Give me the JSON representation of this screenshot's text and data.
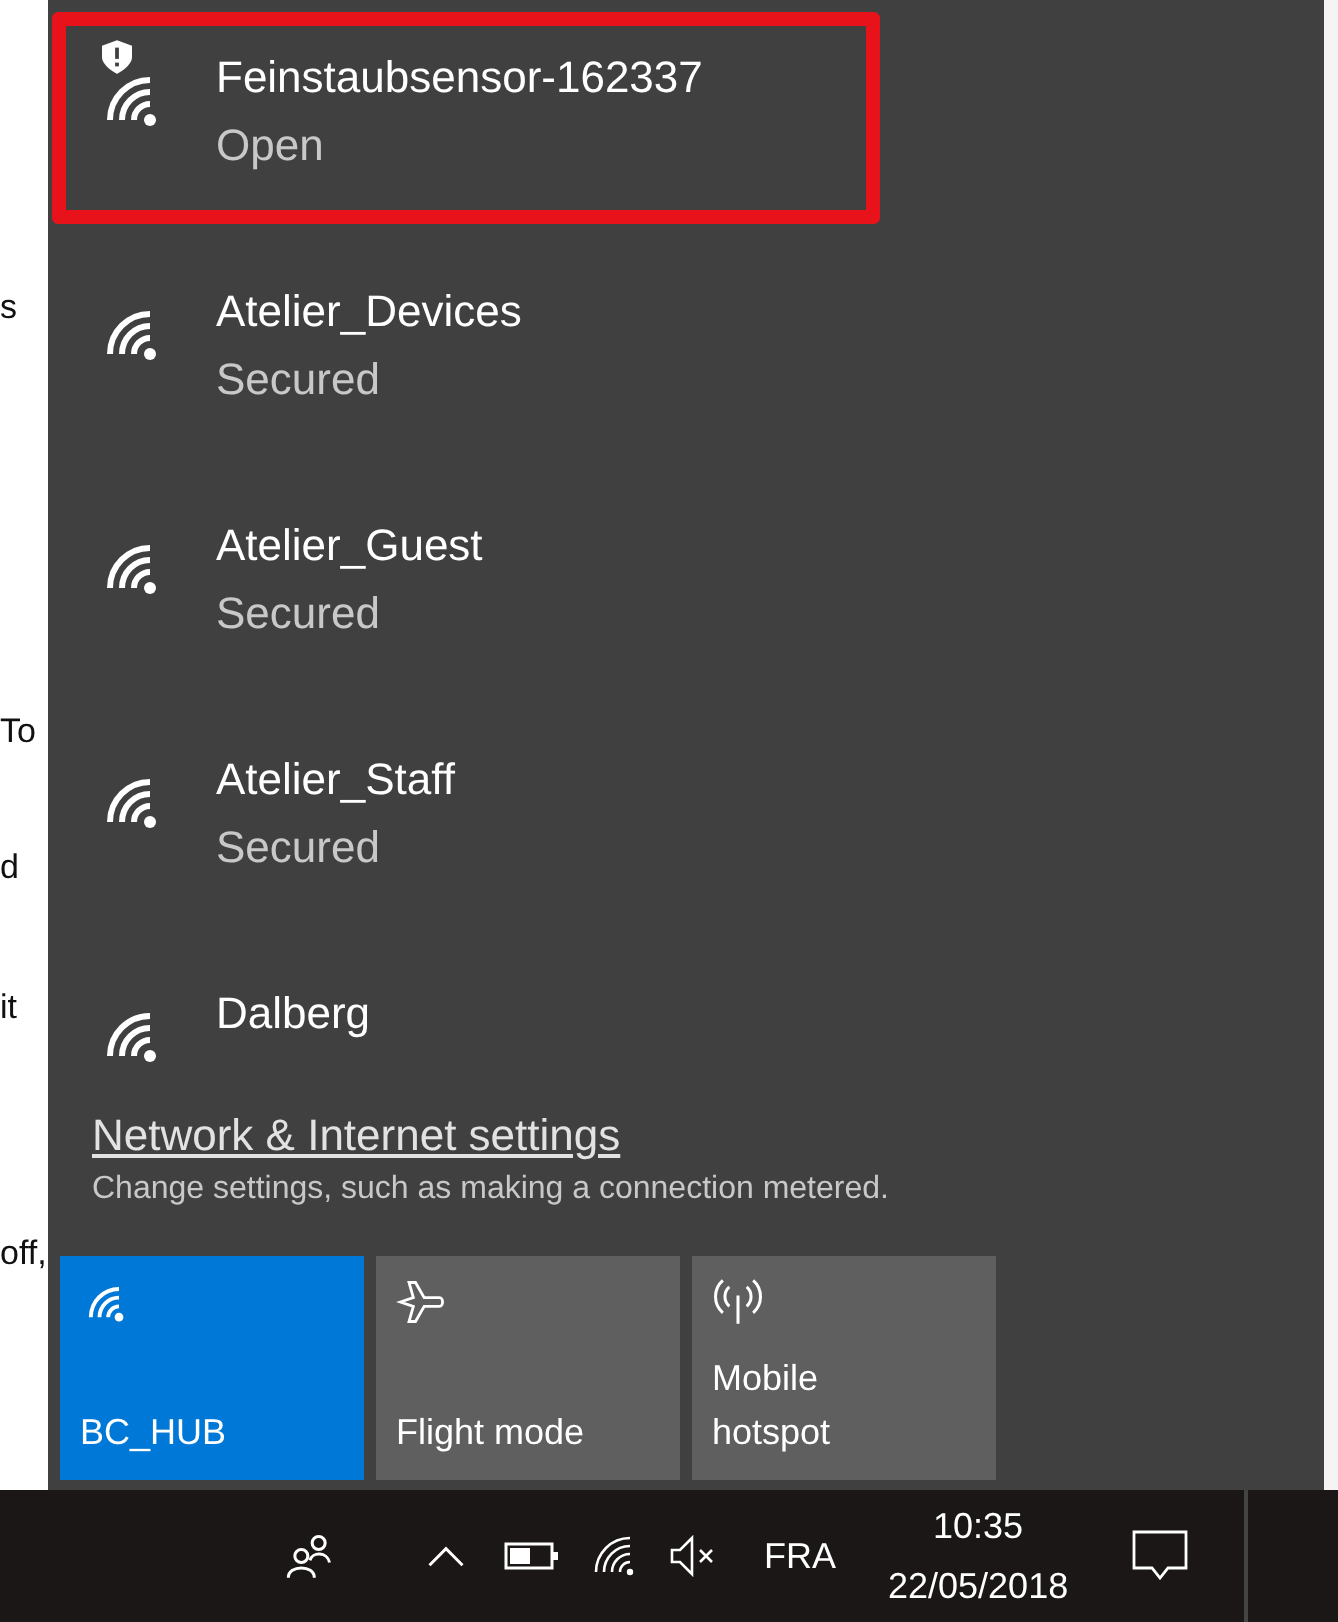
{
  "background_fragments": [
    "s",
    "To",
    "d",
    "it",
    "off,"
  ],
  "networks": [
    {
      "name": "Feinstaubsensor-162337",
      "status": "Open",
      "warning": true,
      "highlighted": true
    },
    {
      "name": "Atelier_Devices",
      "status": "Secured",
      "warning": false,
      "highlighted": false
    },
    {
      "name": "Atelier_Guest",
      "status": "Secured",
      "warning": false,
      "highlighted": false
    },
    {
      "name": "Atelier_Staff",
      "status": "Secured",
      "warning": false,
      "highlighted": false
    },
    {
      "name": "Dalberg",
      "warning": false,
      "highlighted": false
    }
  ],
  "settings_link": "Network & Internet settings",
  "settings_description": "Change settings, such as making a connection metered.",
  "tiles": [
    {
      "kind": "wifi",
      "label": "BC_HUB",
      "selected": true
    },
    {
      "kind": "plane",
      "label": "Flight mode",
      "selected": false
    },
    {
      "kind": "hotspot",
      "label": "Mobile hotspot",
      "selected": false
    }
  ],
  "taskbar": {
    "language": "FRA",
    "time": "10:35",
    "date": "22/05/2018"
  }
}
